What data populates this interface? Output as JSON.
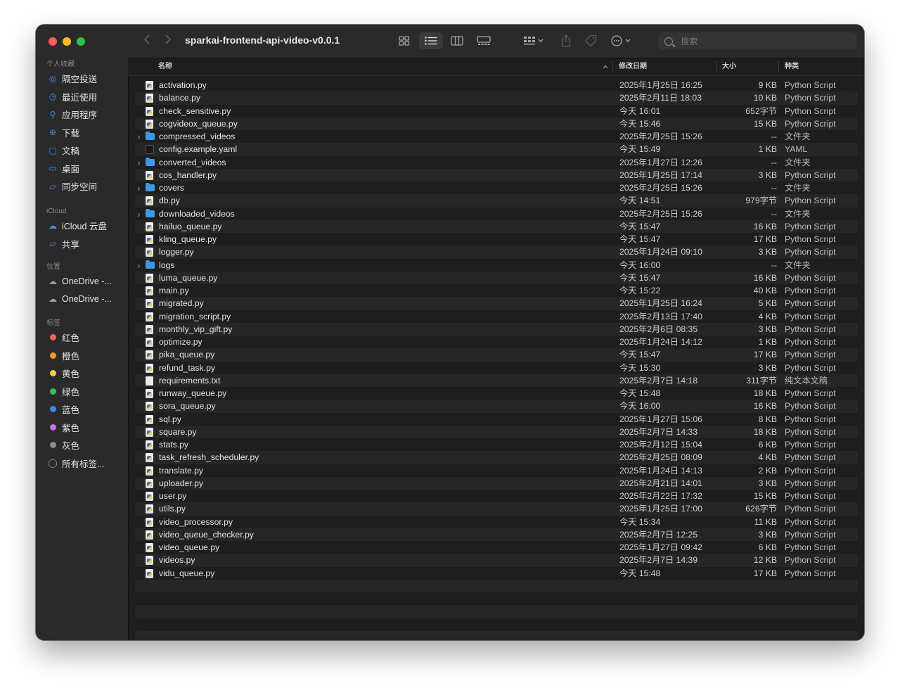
{
  "window": {
    "title": "sparkai-frontend-api-video-v0.0.1"
  },
  "toolbar": {
    "back_icon": "chevron-left-icon",
    "forward_icon": "chevron-right-icon",
    "view_modes": [
      "icon-view",
      "list-view",
      "column-view",
      "gallery-view"
    ],
    "active_view": "list-view",
    "search_placeholder": "搜索"
  },
  "sidebar": {
    "sections": [
      {
        "heading": "个人收藏",
        "items": [
          {
            "label": "隔空投送",
            "icon": "airdrop-icon"
          },
          {
            "label": "最近使用",
            "icon": "clock-icon"
          },
          {
            "label": "应用程序",
            "icon": "applications-icon"
          },
          {
            "label": "下载",
            "icon": "download-icon"
          },
          {
            "label": "文稿",
            "icon": "document-icon"
          },
          {
            "label": "桌面",
            "icon": "desktop-icon"
          },
          {
            "label": "同步空间",
            "icon": "folder-icon"
          }
        ]
      },
      {
        "heading": "iCloud",
        "items": [
          {
            "label": "iCloud 云盘",
            "icon": "cloud-icon"
          },
          {
            "label": "共享",
            "icon": "shared-folder-icon"
          }
        ]
      },
      {
        "heading": "位置",
        "items": [
          {
            "label": "OneDrive -...",
            "icon": "cloud-icon"
          },
          {
            "label": "OneDrive -...",
            "icon": "cloud-icon"
          }
        ]
      },
      {
        "heading": "标签",
        "items": [
          {
            "label": "红色",
            "color": "#fe5f57"
          },
          {
            "label": "橙色",
            "color": "#f59a23"
          },
          {
            "label": "黄色",
            "color": "#f7d038"
          },
          {
            "label": "绿色",
            "color": "#30c84a"
          },
          {
            "label": "蓝色",
            "color": "#2f8ef0"
          },
          {
            "label": "紫色",
            "color": "#c86ee8"
          },
          {
            "label": "灰色",
            "color": "#8e8e8e"
          },
          {
            "label": "所有标签...",
            "icon": "all-tags-icon"
          }
        ]
      }
    ]
  },
  "columns": {
    "name": "名称",
    "date": "修改日期",
    "size": "大小",
    "kind": "种类"
  },
  "files": [
    {
      "name": "activation.py",
      "date": "2025年1月25日 16:25",
      "size": "9 KB",
      "kind": "Python Script",
      "type": "py"
    },
    {
      "name": "balance.py",
      "date": "2025年2月11日 18:03",
      "size": "10 KB",
      "kind": "Python Script",
      "type": "py"
    },
    {
      "name": "check_sensitive.py",
      "date": "今天 16:01",
      "size": "652字节",
      "kind": "Python Script",
      "type": "py"
    },
    {
      "name": "cogvideox_queue.py",
      "date": "今天 15:46",
      "size": "15 KB",
      "kind": "Python Script",
      "type": "py"
    },
    {
      "name": "compressed_videos",
      "date": "2025年2月25日 15:26",
      "size": "--",
      "kind": "文件夹",
      "type": "folder"
    },
    {
      "name": "config.example.yaml",
      "date": "今天 15:49",
      "size": "1 KB",
      "kind": "YAML",
      "type": "yaml"
    },
    {
      "name": "converted_videos",
      "date": "2025年1月27日 12:26",
      "size": "--",
      "kind": "文件夹",
      "type": "folder"
    },
    {
      "name": "cos_handler.py",
      "date": "2025年1月25日 17:14",
      "size": "3 KB",
      "kind": "Python Script",
      "type": "py"
    },
    {
      "name": "covers",
      "date": "2025年2月25日 15:26",
      "size": "--",
      "kind": "文件夹",
      "type": "folder"
    },
    {
      "name": "db.py",
      "date": "今天 14:51",
      "size": "979字节",
      "kind": "Python Script",
      "type": "py"
    },
    {
      "name": "downloaded_videos",
      "date": "2025年2月25日 15:26",
      "size": "--",
      "kind": "文件夹",
      "type": "folder"
    },
    {
      "name": "hailuo_queue.py",
      "date": "今天 15:47",
      "size": "16 KB",
      "kind": "Python Script",
      "type": "py"
    },
    {
      "name": "kling_queue.py",
      "date": "今天 15:47",
      "size": "17 KB",
      "kind": "Python Script",
      "type": "py"
    },
    {
      "name": "logger.py",
      "date": "2025年1月24日 09:10",
      "size": "3 KB",
      "kind": "Python Script",
      "type": "py"
    },
    {
      "name": "logs",
      "date": "今天 16:00",
      "size": "--",
      "kind": "文件夹",
      "type": "folder"
    },
    {
      "name": "luma_queue.py",
      "date": "今天 15:47",
      "size": "16 KB",
      "kind": "Python Script",
      "type": "py"
    },
    {
      "name": "main.py",
      "date": "今天 15:22",
      "size": "40 KB",
      "kind": "Python Script",
      "type": "py"
    },
    {
      "name": "migrated.py",
      "date": "2025年1月25日 16:24",
      "size": "5 KB",
      "kind": "Python Script",
      "type": "py"
    },
    {
      "name": "migration_script.py",
      "date": "2025年2月13日 17:40",
      "size": "4 KB",
      "kind": "Python Script",
      "type": "py"
    },
    {
      "name": "monthly_vip_gift.py",
      "date": "2025年2月6日 08:35",
      "size": "3 KB",
      "kind": "Python Script",
      "type": "py"
    },
    {
      "name": "optimize.py",
      "date": "2025年1月24日 14:12",
      "size": "1 KB",
      "kind": "Python Script",
      "type": "py"
    },
    {
      "name": "pika_queue.py",
      "date": "今天 15:47",
      "size": "17 KB",
      "kind": "Python Script",
      "type": "py"
    },
    {
      "name": "refund_task.py",
      "date": "今天 15:30",
      "size": "3 KB",
      "kind": "Python Script",
      "type": "py"
    },
    {
      "name": "requirements.txt",
      "date": "2025年2月7日 14:18",
      "size": "311字节",
      "kind": "纯文本文稿",
      "type": "txt"
    },
    {
      "name": "runway_queue.py",
      "date": "今天 15:48",
      "size": "18 KB",
      "kind": "Python Script",
      "type": "py"
    },
    {
      "name": "sora_queue.py",
      "date": "今天 16:00",
      "size": "16 KB",
      "kind": "Python Script",
      "type": "py"
    },
    {
      "name": "sql.py",
      "date": "2025年1月27日 15:06",
      "size": "8 KB",
      "kind": "Python Script",
      "type": "py"
    },
    {
      "name": "square.py",
      "date": "2025年2月7日 14:33",
      "size": "18 KB",
      "kind": "Python Script",
      "type": "py"
    },
    {
      "name": "stats.py",
      "date": "2025年2月12日 15:04",
      "size": "6 KB",
      "kind": "Python Script",
      "type": "py"
    },
    {
      "name": "task_refresh_scheduler.py",
      "date": "2025年2月25日 08:09",
      "size": "4 KB",
      "kind": "Python Script",
      "type": "py"
    },
    {
      "name": "translate.py",
      "date": "2025年1月24日 14:13",
      "size": "2 KB",
      "kind": "Python Script",
      "type": "py"
    },
    {
      "name": "uploader.py",
      "date": "2025年2月21日 14:01",
      "size": "3 KB",
      "kind": "Python Script",
      "type": "py"
    },
    {
      "name": "user.py",
      "date": "2025年2月22日 17:32",
      "size": "15 KB",
      "kind": "Python Script",
      "type": "py"
    },
    {
      "name": "utils.py",
      "date": "2025年1月25日 17:00",
      "size": "626字节",
      "kind": "Python Script",
      "type": "py"
    },
    {
      "name": "video_processor.py",
      "date": "今天 15:34",
      "size": "11 KB",
      "kind": "Python Script",
      "type": "py"
    },
    {
      "name": "video_queue_checker.py",
      "date": "2025年2月7日 12:25",
      "size": "3 KB",
      "kind": "Python Script",
      "type": "py"
    },
    {
      "name": "video_queue.py",
      "date": "2025年1月27日 09:42",
      "size": "6 KB",
      "kind": "Python Script",
      "type": "py"
    },
    {
      "name": "videos.py",
      "date": "2025年2月7日 14:39",
      "size": "12 KB",
      "kind": "Python Script",
      "type": "py"
    },
    {
      "name": "vidu_queue.py",
      "date": "今天 15:48",
      "size": "17 KB",
      "kind": "Python Script",
      "type": "py"
    }
  ]
}
